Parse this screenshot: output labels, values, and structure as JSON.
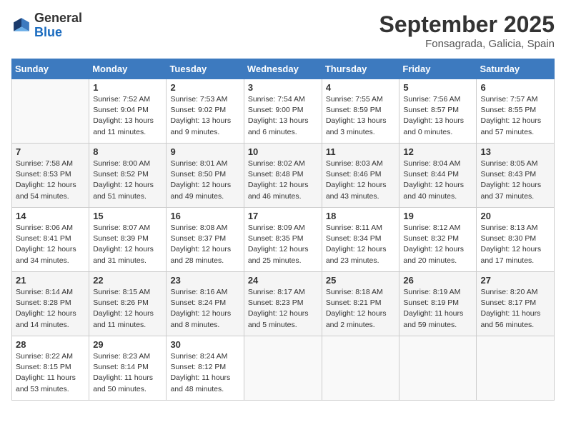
{
  "header": {
    "logo_general": "General",
    "logo_blue": "Blue",
    "month": "September 2025",
    "location": "Fonsagrada, Galicia, Spain"
  },
  "weekdays": [
    "Sunday",
    "Monday",
    "Tuesday",
    "Wednesday",
    "Thursday",
    "Friday",
    "Saturday"
  ],
  "weeks": [
    [
      {
        "day": "",
        "sunrise": "",
        "sunset": "",
        "daylight": ""
      },
      {
        "day": "1",
        "sunrise": "Sunrise: 7:52 AM",
        "sunset": "Sunset: 9:04 PM",
        "daylight": "Daylight: 13 hours and 11 minutes."
      },
      {
        "day": "2",
        "sunrise": "Sunrise: 7:53 AM",
        "sunset": "Sunset: 9:02 PM",
        "daylight": "Daylight: 13 hours and 9 minutes."
      },
      {
        "day": "3",
        "sunrise": "Sunrise: 7:54 AM",
        "sunset": "Sunset: 9:00 PM",
        "daylight": "Daylight: 13 hours and 6 minutes."
      },
      {
        "day": "4",
        "sunrise": "Sunrise: 7:55 AM",
        "sunset": "Sunset: 8:59 PM",
        "daylight": "Daylight: 13 hours and 3 minutes."
      },
      {
        "day": "5",
        "sunrise": "Sunrise: 7:56 AM",
        "sunset": "Sunset: 8:57 PM",
        "daylight": "Daylight: 13 hours and 0 minutes."
      },
      {
        "day": "6",
        "sunrise": "Sunrise: 7:57 AM",
        "sunset": "Sunset: 8:55 PM",
        "daylight": "Daylight: 12 hours and 57 minutes."
      }
    ],
    [
      {
        "day": "7",
        "sunrise": "Sunrise: 7:58 AM",
        "sunset": "Sunset: 8:53 PM",
        "daylight": "Daylight: 12 hours and 54 minutes."
      },
      {
        "day": "8",
        "sunrise": "Sunrise: 8:00 AM",
        "sunset": "Sunset: 8:52 PM",
        "daylight": "Daylight: 12 hours and 51 minutes."
      },
      {
        "day": "9",
        "sunrise": "Sunrise: 8:01 AM",
        "sunset": "Sunset: 8:50 PM",
        "daylight": "Daylight: 12 hours and 49 minutes."
      },
      {
        "day": "10",
        "sunrise": "Sunrise: 8:02 AM",
        "sunset": "Sunset: 8:48 PM",
        "daylight": "Daylight: 12 hours and 46 minutes."
      },
      {
        "day": "11",
        "sunrise": "Sunrise: 8:03 AM",
        "sunset": "Sunset: 8:46 PM",
        "daylight": "Daylight: 12 hours and 43 minutes."
      },
      {
        "day": "12",
        "sunrise": "Sunrise: 8:04 AM",
        "sunset": "Sunset: 8:44 PM",
        "daylight": "Daylight: 12 hours and 40 minutes."
      },
      {
        "day": "13",
        "sunrise": "Sunrise: 8:05 AM",
        "sunset": "Sunset: 8:43 PM",
        "daylight": "Daylight: 12 hours and 37 minutes."
      }
    ],
    [
      {
        "day": "14",
        "sunrise": "Sunrise: 8:06 AM",
        "sunset": "Sunset: 8:41 PM",
        "daylight": "Daylight: 12 hours and 34 minutes."
      },
      {
        "day": "15",
        "sunrise": "Sunrise: 8:07 AM",
        "sunset": "Sunset: 8:39 PM",
        "daylight": "Daylight: 12 hours and 31 minutes."
      },
      {
        "day": "16",
        "sunrise": "Sunrise: 8:08 AM",
        "sunset": "Sunset: 8:37 PM",
        "daylight": "Daylight: 12 hours and 28 minutes."
      },
      {
        "day": "17",
        "sunrise": "Sunrise: 8:09 AM",
        "sunset": "Sunset: 8:35 PM",
        "daylight": "Daylight: 12 hours and 25 minutes."
      },
      {
        "day": "18",
        "sunrise": "Sunrise: 8:11 AM",
        "sunset": "Sunset: 8:34 PM",
        "daylight": "Daylight: 12 hours and 23 minutes."
      },
      {
        "day": "19",
        "sunrise": "Sunrise: 8:12 AM",
        "sunset": "Sunset: 8:32 PM",
        "daylight": "Daylight: 12 hours and 20 minutes."
      },
      {
        "day": "20",
        "sunrise": "Sunrise: 8:13 AM",
        "sunset": "Sunset: 8:30 PM",
        "daylight": "Daylight: 12 hours and 17 minutes."
      }
    ],
    [
      {
        "day": "21",
        "sunrise": "Sunrise: 8:14 AM",
        "sunset": "Sunset: 8:28 PM",
        "daylight": "Daylight: 12 hours and 14 minutes."
      },
      {
        "day": "22",
        "sunrise": "Sunrise: 8:15 AM",
        "sunset": "Sunset: 8:26 PM",
        "daylight": "Daylight: 12 hours and 11 minutes."
      },
      {
        "day": "23",
        "sunrise": "Sunrise: 8:16 AM",
        "sunset": "Sunset: 8:24 PM",
        "daylight": "Daylight: 12 hours and 8 minutes."
      },
      {
        "day": "24",
        "sunrise": "Sunrise: 8:17 AM",
        "sunset": "Sunset: 8:23 PM",
        "daylight": "Daylight: 12 hours and 5 minutes."
      },
      {
        "day": "25",
        "sunrise": "Sunrise: 8:18 AM",
        "sunset": "Sunset: 8:21 PM",
        "daylight": "Daylight: 12 hours and 2 minutes."
      },
      {
        "day": "26",
        "sunrise": "Sunrise: 8:19 AM",
        "sunset": "Sunset: 8:19 PM",
        "daylight": "Daylight: 11 hours and 59 minutes."
      },
      {
        "day": "27",
        "sunrise": "Sunrise: 8:20 AM",
        "sunset": "Sunset: 8:17 PM",
        "daylight": "Daylight: 11 hours and 56 minutes."
      }
    ],
    [
      {
        "day": "28",
        "sunrise": "Sunrise: 8:22 AM",
        "sunset": "Sunset: 8:15 PM",
        "daylight": "Daylight: 11 hours and 53 minutes."
      },
      {
        "day": "29",
        "sunrise": "Sunrise: 8:23 AM",
        "sunset": "Sunset: 8:14 PM",
        "daylight": "Daylight: 11 hours and 50 minutes."
      },
      {
        "day": "30",
        "sunrise": "Sunrise: 8:24 AM",
        "sunset": "Sunset: 8:12 PM",
        "daylight": "Daylight: 11 hours and 48 minutes."
      },
      {
        "day": "",
        "sunrise": "",
        "sunset": "",
        "daylight": ""
      },
      {
        "day": "",
        "sunrise": "",
        "sunset": "",
        "daylight": ""
      },
      {
        "day": "",
        "sunrise": "",
        "sunset": "",
        "daylight": ""
      },
      {
        "day": "",
        "sunrise": "",
        "sunset": "",
        "daylight": ""
      }
    ]
  ]
}
